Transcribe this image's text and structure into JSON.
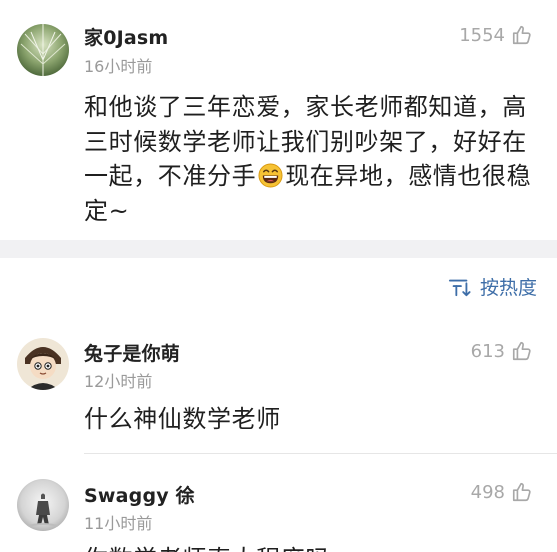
{
  "comments": [
    {
      "username": "家0Jasm",
      "time": "16小时前",
      "likes": "1554",
      "avatar_icon": "avatar-icon",
      "content_lines": [
        "和他谈了三年恋爱，家长老师都知道，高",
        "三时候数学老师让我们别吵架了，好好在",
        "一起，不准分手",
        "现在异地，感情也很稳",
        "定~"
      ],
      "emoji": "laughing-emoji-icon"
    },
    {
      "username": "兔子是你萌",
      "time": "12小时前",
      "likes": "613",
      "avatar_icon": "avatar-icon",
      "content_lines": [
        "什么神仙数学老师"
      ]
    },
    {
      "username": "Swaggy 徐",
      "time": "11小时前",
      "likes": "498",
      "avatar_icon": "avatar-icon",
      "content_lines": [
        "你数学老师真大程度吗"
      ]
    }
  ],
  "sort": {
    "label": "按热度",
    "icon": "sort-icon"
  },
  "colors": {
    "accent": "#3e6ea8",
    "muted": "#9a9a9a",
    "gap": "#f1f1f3"
  }
}
